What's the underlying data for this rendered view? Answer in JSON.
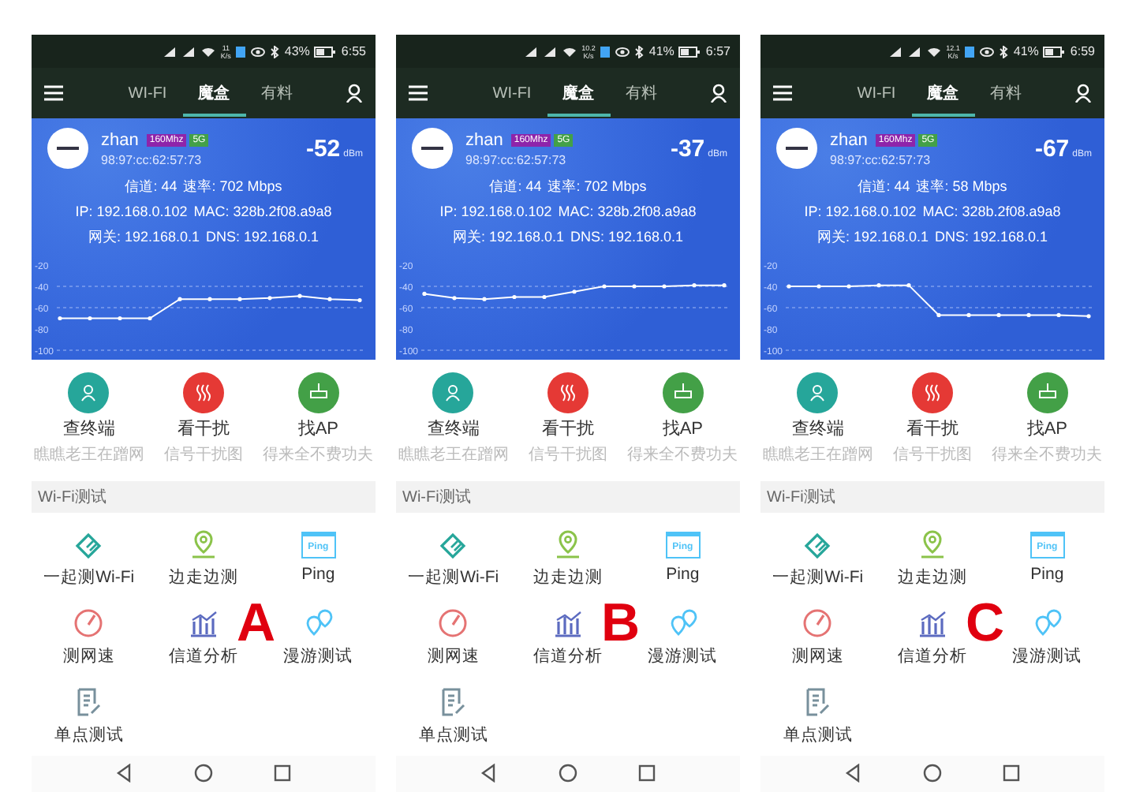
{
  "screens": [
    {
      "status_bar": {
        "net_speed_value": "11",
        "net_speed_unit": "K/s",
        "battery": "43%",
        "time": "6:55"
      },
      "tabs": [
        {
          "label": "WI-FI",
          "selected": false
        },
        {
          "label": "魔盒",
          "selected": true
        },
        {
          "label": "有料",
          "selected": false
        }
      ],
      "network": {
        "name": "zhan",
        "badges": [
          {
            "label": "160Mhz",
            "color": "#8e24aa"
          },
          {
            "label": "5G",
            "color": "#43a047"
          }
        ],
        "mac": "98:97:cc:62:57:73",
        "rssi": "-52",
        "rssi_unit": "dBm"
      },
      "info_lines": [
        [
          {
            "label": "信道:",
            "value": "44"
          },
          {
            "label": "速率:",
            "value": "702 Mbps"
          }
        ],
        [
          {
            "label": "IP:",
            "value": "192.168.0.102"
          },
          {
            "label": "MAC:",
            "value": "328b.2f08.a9a8"
          }
        ],
        [
          {
            "label": "网关:",
            "value": "192.168.0.1"
          },
          {
            "label": "DNS:",
            "value": "192.168.0.1"
          }
        ]
      ],
      "chart_data": {
        "type": "line",
        "ylim": [
          -100,
          -20
        ],
        "yticks": [
          -20,
          -40,
          -60,
          -80,
          -100
        ],
        "series": [
          {
            "color": "#ffffff",
            "values": [
              -70,
              -70,
              -70,
              -70,
              -52,
              -52,
              -52,
              -51,
              -49,
              -52,
              -53
            ]
          }
        ]
      },
      "quick_actions": [
        {
          "title": "查终端",
          "subtitle": "瞧瞧老王在蹭网",
          "color": "#26a69a"
        },
        {
          "title": "看干扰",
          "subtitle": "信号干扰图",
          "color": "#e53935"
        },
        {
          "title": "找AP",
          "subtitle": "得来全不费功夫",
          "color": "#43a047"
        }
      ],
      "section_title": "Wi-Fi测试",
      "tools": [
        {
          "label": "一起测Wi-Fi"
        },
        {
          "label": "边走边测"
        },
        {
          "label": "Ping",
          "icon_text": "Ping"
        },
        {
          "label": "测网速"
        },
        {
          "label": "信道分析"
        },
        {
          "label": "漫游测试"
        },
        {
          "label": "单点测试"
        }
      ],
      "overlay_label": "A"
    },
    {
      "status_bar": {
        "net_speed_value": "10.2",
        "net_speed_unit": "K/s",
        "battery": "41%",
        "time": "6:57"
      },
      "tabs": [
        {
          "label": "WI-FI",
          "selected": false
        },
        {
          "label": "魔盒",
          "selected": true
        },
        {
          "label": "有料",
          "selected": false
        }
      ],
      "network": {
        "name": "zhan",
        "badges": [
          {
            "label": "160Mhz",
            "color": "#8e24aa"
          },
          {
            "label": "5G",
            "color": "#43a047"
          }
        ],
        "mac": "98:97:cc:62:57:73",
        "rssi": "-37",
        "rssi_unit": "dBm"
      },
      "info_lines": [
        [
          {
            "label": "信道:",
            "value": "44"
          },
          {
            "label": "速率:",
            "value": "702 Mbps"
          }
        ],
        [
          {
            "label": "IP:",
            "value": "192.168.0.102"
          },
          {
            "label": "MAC:",
            "value": "328b.2f08.a9a8"
          }
        ],
        [
          {
            "label": "网关:",
            "value": "192.168.0.1"
          },
          {
            "label": "DNS:",
            "value": "192.168.0.1"
          }
        ]
      ],
      "chart_data": {
        "type": "line",
        "ylim": [
          -100,
          -20
        ],
        "yticks": [
          -20,
          -40,
          -60,
          -80,
          -100
        ],
        "series": [
          {
            "color": "#ffffff",
            "values": [
              -47,
              -51,
              -52,
              -50,
              -50,
              -45,
              -40,
              -40,
              -40,
              -39,
              -39
            ]
          }
        ]
      },
      "quick_actions": [
        {
          "title": "查终端",
          "subtitle": "瞧瞧老王在蹭网",
          "color": "#26a69a"
        },
        {
          "title": "看干扰",
          "subtitle": "信号干扰图",
          "color": "#e53935"
        },
        {
          "title": "找AP",
          "subtitle": "得来全不费功夫",
          "color": "#43a047"
        }
      ],
      "section_title": "Wi-Fi测试",
      "tools": [
        {
          "label": "一起测Wi-Fi"
        },
        {
          "label": "边走边测"
        },
        {
          "label": "Ping",
          "icon_text": "Ping"
        },
        {
          "label": "测网速"
        },
        {
          "label": "信道分析"
        },
        {
          "label": "漫游测试"
        },
        {
          "label": "单点测试"
        }
      ],
      "overlay_label": "B"
    },
    {
      "status_bar": {
        "net_speed_value": "12.1",
        "net_speed_unit": "K/s",
        "battery": "41%",
        "time": "6:59"
      },
      "tabs": [
        {
          "label": "WI-FI",
          "selected": false
        },
        {
          "label": "魔盒",
          "selected": true
        },
        {
          "label": "有料",
          "selected": false
        }
      ],
      "network": {
        "name": "zhan",
        "badges": [
          {
            "label": "160Mhz",
            "color": "#8e24aa"
          },
          {
            "label": "5G",
            "color": "#43a047"
          }
        ],
        "mac": "98:97:cc:62:57:73",
        "rssi": "-67",
        "rssi_unit": "dBm"
      },
      "info_lines": [
        [
          {
            "label": "信道:",
            "value": "44"
          },
          {
            "label": "速率:",
            "value": "58 Mbps"
          }
        ],
        [
          {
            "label": "IP:",
            "value": "192.168.0.102"
          },
          {
            "label": "MAC:",
            "value": "328b.2f08.a9a8"
          }
        ],
        [
          {
            "label": "网关:",
            "value": "192.168.0.1"
          },
          {
            "label": "DNS:",
            "value": "192.168.0.1"
          }
        ]
      ],
      "chart_data": {
        "type": "line",
        "ylim": [
          -100,
          -20
        ],
        "yticks": [
          -20,
          -40,
          -60,
          -80,
          -100
        ],
        "series": [
          {
            "color": "#ffffff",
            "values": [
              -40,
              -40,
              -40,
              -39,
              -39,
              -67,
              -67,
              -67,
              -67,
              -67,
              -68
            ]
          }
        ]
      },
      "quick_actions": [
        {
          "title": "查终端",
          "subtitle": "瞧瞧老王在蹭网",
          "color": "#26a69a"
        },
        {
          "title": "看干扰",
          "subtitle": "信号干扰图",
          "color": "#e53935"
        },
        {
          "title": "找AP",
          "subtitle": "得来全不费功夫",
          "color": "#43a047"
        }
      ],
      "section_title": "Wi-Fi测试",
      "tools": [
        {
          "label": "一起测Wi-Fi"
        },
        {
          "label": "边走边测"
        },
        {
          "label": "Ping",
          "icon_text": "Ping"
        },
        {
          "label": "测网速"
        },
        {
          "label": "信道分析"
        },
        {
          "label": "漫游测试"
        },
        {
          "label": "单点测试"
        }
      ],
      "overlay_label": "C"
    }
  ]
}
